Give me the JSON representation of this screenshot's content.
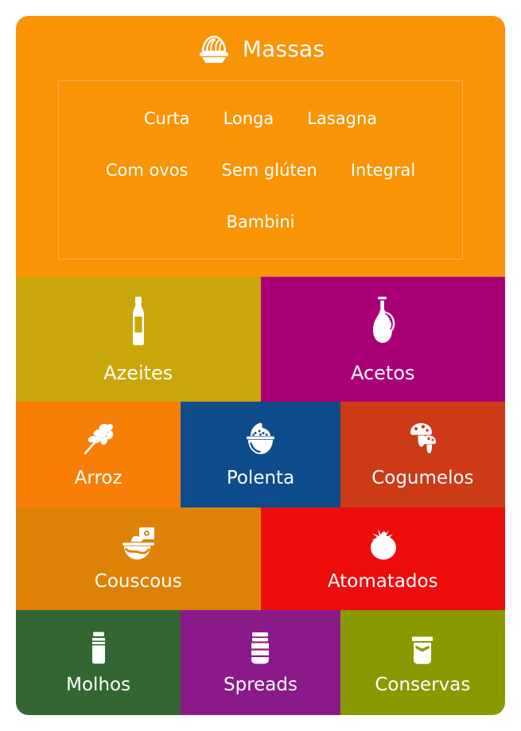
{
  "header": {
    "title": "Massas",
    "icon": "pasta-bowl-icon",
    "background_color": "#f99406",
    "tag_rows": [
      [
        "Curta",
        "Longa",
        "Lasagna"
      ],
      [
        "Com ovos",
        "Sem glúten",
        "Integral"
      ],
      [
        "Bambini"
      ]
    ]
  },
  "tiles": {
    "rows": [
      [
        {
          "label": "Azeites",
          "icon": "oil-bottle-icon",
          "color": "#c9a70a"
        },
        {
          "label": "Acetos",
          "icon": "vinegar-cruet-icon",
          "color": "#aa0077"
        }
      ],
      [
        {
          "label": "Arroz",
          "icon": "wheat-stalk-icon",
          "color": "#f77f07"
        },
        {
          "label": "Polenta",
          "icon": "rice-bowl-icon",
          "color": "#0f4c8c"
        },
        {
          "label": "Cogumelos",
          "icon": "mushrooms-icon",
          "color": "#cc3a17"
        }
      ],
      [
        {
          "label": "Couscous",
          "icon": "bowl-spoon-icon",
          "color": "#dd8206"
        },
        {
          "label": "Atomatados",
          "icon": "tomato-icon",
          "color": "#ee0d0d"
        }
      ],
      [
        {
          "label": "Molhos",
          "icon": "sauce-bottle-icon",
          "color": "#336633"
        },
        {
          "label": "Spreads",
          "icon": "spread-jar-icon",
          "color": "#8a1a8a"
        },
        {
          "label": "Conservas",
          "icon": "preserve-jar-icon",
          "color": "#8a9900"
        }
      ]
    ]
  }
}
